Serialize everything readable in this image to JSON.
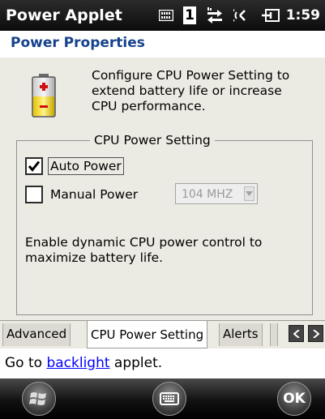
{
  "titlebar": {
    "app_title": "Power Applet",
    "signal_badge": "1",
    "time": "1:59",
    "icons": [
      "keypad-status-icon",
      "number-one-icon",
      "connectivity-icon",
      "speaker-icon",
      "battery-charging-icon"
    ]
  },
  "header": {
    "title": "Power Properties"
  },
  "content": {
    "description": "Configure CPU Power Setting to extend battery life or increase CPU performance.",
    "group_title": "CPU Power Setting",
    "auto_power": {
      "label": "Auto Power",
      "checked": true
    },
    "manual_power": {
      "label": "Manual Power",
      "checked": false
    },
    "cpu_speed": {
      "value": "104 MHZ"
    },
    "help_text": "Enable dynamic CPU power control to maximize battery life."
  },
  "tabs": {
    "items": [
      "Advanced",
      "CPU Power Setting",
      "Alerts"
    ],
    "active": "CPU Power Setting",
    "scroll_left": "<",
    "scroll_right": ">"
  },
  "link_line": {
    "prefix": "Go to ",
    "link": "backlight",
    "suffix": " applet."
  },
  "bottombar": {
    "ok_label": "OK"
  },
  "colors": {
    "title_bar": "#111111",
    "header_text": "#15428b",
    "content_bg": "#ecebe3",
    "link": "#0000ff"
  }
}
